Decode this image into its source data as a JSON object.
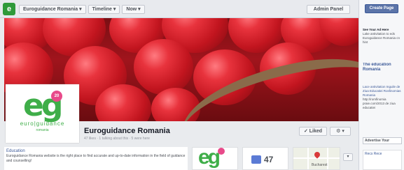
{
  "topbar": {
    "logo_letter": "e",
    "crumbs": [
      "Euroguidance Romania",
      "Timeline",
      "Now"
    ],
    "admin_label": "Admin Panel"
  },
  "sidebar": {
    "create_label": "Create Page",
    "block1_title": "See Your Ad Here",
    "block1_text": "Lake antivitation to eds Euroguidance Romania cn hint",
    "ad1_title": "The education Romania",
    "block2_title": "Lace antivitation Inguile de Ziua Educatiei Rosfinomias Romania",
    "block2_text": "http://romfinomia praie.com/2013 de ziua educatiei",
    "btn_label": "Advertise Your",
    "bottom_text": "Recs Rece"
  },
  "profile": {
    "mark": "eg",
    "badge": "20",
    "line1": "euro|guidance",
    "line2": "romania"
  },
  "page": {
    "name": "Euroguidance Romania",
    "stats": "47 likes · 1 talking about this · 5 were here",
    "liked_label": "✓ Liked",
    "gear_label": "⚙ ▾"
  },
  "about": {
    "title": "Education",
    "text": "Euroguidance Romania website is the right place to find accurate and up-to-date information in the field of guidance and counselling!"
  },
  "likes": {
    "count": "47"
  },
  "map": {
    "label": "Bucharest"
  },
  "more_label": "▾",
  "colors": {
    "brand_green": "#3fae49",
    "fb_blue": "#3b5998",
    "badge_pink": "#e84a8a"
  }
}
